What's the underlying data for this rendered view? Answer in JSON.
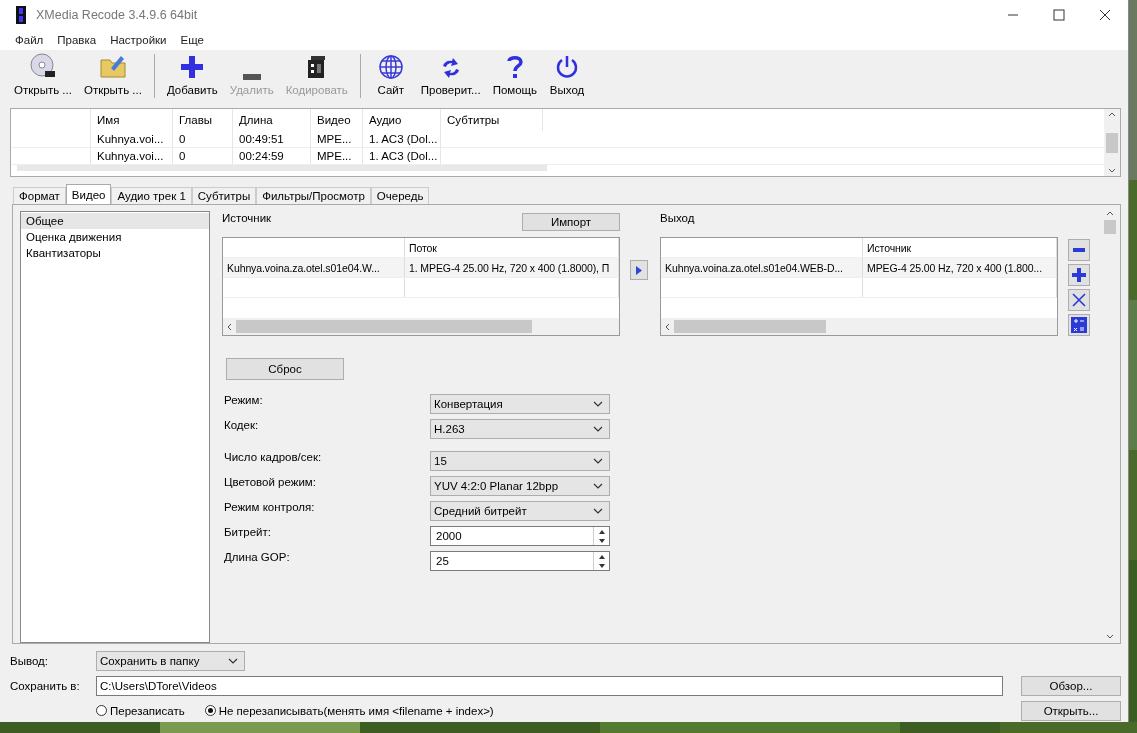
{
  "window": {
    "title": "XMedia Recode 3.4.9.6 64bit"
  },
  "menu": [
    "Файл",
    "Правка",
    "Настройки",
    "Еще"
  ],
  "toolbar": [
    {
      "kind": "disc",
      "label": "Открыть ...",
      "disabled": false,
      "separator_before": false
    },
    {
      "kind": "folder",
      "label": "Открыть ...",
      "disabled": false,
      "separator_before": false
    },
    {
      "kind": "plus",
      "label": "Добавить",
      "disabled": false,
      "separator_before": true
    },
    {
      "kind": "minus",
      "label": "Удалить",
      "disabled": true,
      "separator_before": false
    },
    {
      "kind": "encode",
      "label": "Кодировать",
      "disabled": true,
      "separator_before": false
    },
    {
      "kind": "globe",
      "label": "Сайт",
      "disabled": false,
      "separator_before": true
    },
    {
      "kind": "refresh",
      "label": "Проверит...",
      "disabled": false,
      "separator_before": false
    },
    {
      "kind": "help",
      "label": "Помощь",
      "disabled": false,
      "separator_before": false
    },
    {
      "kind": "power",
      "label": "Выход",
      "disabled": false,
      "separator_before": false
    }
  ],
  "file_list": {
    "columns": [
      "Имя",
      "Главы",
      "Длина",
      "Видео",
      "Аудио",
      "Субтитры"
    ],
    "rows": [
      [
        "Kuhnya.voi...",
        "0",
        "00:49:51",
        "MPE...",
        "1. AC3 (Dol..."
      ],
      [
        "Kuhnya.voi...",
        "0",
        "00:24:59",
        "MPE...",
        "1. AC3 (Dol..."
      ]
    ]
  },
  "tabs": [
    {
      "label": "Формат",
      "selected": false
    },
    {
      "label": "Видео",
      "selected": true
    },
    {
      "label": "Аудио трек 1",
      "selected": false
    },
    {
      "label": "Субтитры",
      "selected": false
    },
    {
      "label": "Фильтры/Просмотр",
      "selected": false
    },
    {
      "label": "Очередь",
      "selected": false
    }
  ],
  "sidebar": {
    "items": [
      {
        "label": "Общее",
        "selected": true
      },
      {
        "label": "Оценка движения",
        "selected": false
      },
      {
        "label": "Квантизаторы",
        "selected": false
      }
    ]
  },
  "source": {
    "label": "Источник",
    "import_button": "Импорт",
    "columns": [
      "",
      "Поток"
    ],
    "rows": [
      [
        "Kuhnya.voina.za.otel.s01e04.W...",
        "1. MPEG-4 25.00 Hz, 720 x 400 (1.8000), П"
      ]
    ]
  },
  "output": {
    "label": "Выход",
    "columns": [
      "",
      "Источник"
    ],
    "rows": [
      [
        "Kuhnya.voina.za.otel.s01e04.WEB-D...",
        "MPEG-4 25.00 Hz, 720 x 400 (1.800..."
      ]
    ]
  },
  "reset_button": "Сброс",
  "settings_groups": [
    [
      {
        "label": "Режим:",
        "kind": "dropdown",
        "value": "Конвертация"
      },
      {
        "label": "Кодек:",
        "kind": "dropdown",
        "value": "H.263"
      }
    ],
    [
      {
        "label": "Число кадров/сек:",
        "kind": "dropdown",
        "value": "15"
      },
      {
        "label": "Цветовой режим:",
        "kind": "dropdown",
        "value": "YUV 4:2:0 Planar 12bpp"
      },
      {
        "label": "Режим контроля:",
        "kind": "dropdown",
        "value": "Средний битрейт"
      },
      {
        "label": "Битрейт:",
        "kind": "spinner",
        "value": "2000"
      },
      {
        "label": "Длина GOP:",
        "kind": "spinner",
        "value": "25"
      }
    ]
  ],
  "bottom": {
    "output_label": "Вывод:",
    "output_value": "Сохранить в папку",
    "save_label": "Сохранить в:",
    "path": "C:\\Users\\DTore\\Videos",
    "browse_button": "Обзор...",
    "open_button": "Открыть...",
    "radios": [
      {
        "label": "Перезаписать",
        "selected": false
      },
      {
        "label": "Не перезаписывать(менять имя <filename + index>)",
        "selected": true
      }
    ]
  }
}
